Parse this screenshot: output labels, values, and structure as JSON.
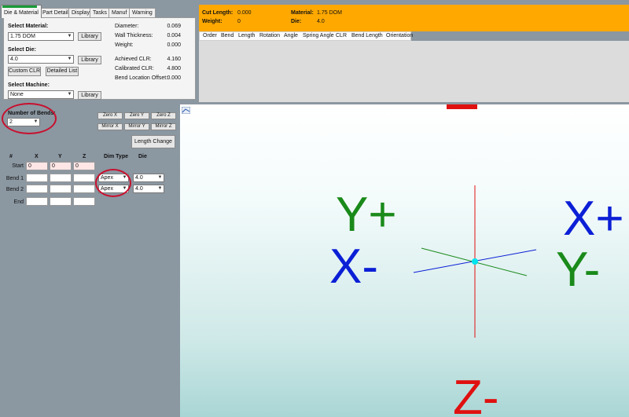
{
  "tabs": [
    {
      "label": "Die & Material",
      "active": true
    },
    {
      "label": "Part Details",
      "active": false
    },
    {
      "label": "Display",
      "active": false
    },
    {
      "label": "Tasks",
      "active": false
    },
    {
      "label": "Manuf",
      "active": false
    },
    {
      "label": "Warning",
      "active": false
    }
  ],
  "material": {
    "label": "Select Material:",
    "value": "1.75 DOM",
    "library_button": "Library"
  },
  "die": {
    "label": "Select Die:",
    "value": "4.0",
    "library_button": "Library",
    "custom_clr_button": "Custom CLR",
    "detailed_list_button": "Detailed List"
  },
  "machine": {
    "label": "Select Machine:",
    "value": "None",
    "library_button": "Library"
  },
  "properties": [
    {
      "label": "Diameter:",
      "value": "0.069"
    },
    {
      "label": "Wall Thickness:",
      "value": "0.004"
    },
    {
      "label": "Weight:",
      "value": "0.000"
    },
    {
      "label": "Achieved CLR:",
      "value": "4.160"
    },
    {
      "label": "Calibrated CLR:",
      "value": "4.800"
    },
    {
      "label": "Bend Location Offset:",
      "value": "0.000"
    }
  ],
  "info": {
    "cut_length_label": "Cut Length:",
    "cut_length_value": "0.000",
    "weight_label": "Weight:",
    "weight_value": "0",
    "material_label": "Material:",
    "material_value": "1.75 DOM",
    "die_label": "Die:",
    "die_value": "4.0"
  },
  "bend_columns": [
    "Order",
    "Bend",
    "Length",
    "Rotation",
    "Angle",
    "Spring Angle",
    "CLR",
    "Bend Length",
    "Orientation"
  ],
  "number_of_bends": {
    "label": "Number of Bends:",
    "value": "2"
  },
  "tools": {
    "zero_x": "Zero X",
    "zero_y": "Zero Y",
    "zero_z": "Zero Z",
    "mirror_x": "Mirror X",
    "mirror_y": "Mirror Y",
    "mirror_z": "Mirror Z",
    "length_change": "Length Change"
  },
  "point_grid": {
    "headers": {
      "num": "#",
      "x": "X",
      "y": "Y",
      "z": "Z",
      "dim_type": "Dim Type",
      "die": "Die"
    },
    "rows": [
      {
        "label": "Start",
        "x": "0",
        "y": "0",
        "z": "0",
        "dim_type": "",
        "die": ""
      },
      {
        "label": "Bend 1",
        "x": "",
        "y": "",
        "z": "",
        "dim_type": "Apex",
        "die": "4.0"
      },
      {
        "label": "Bend 2",
        "x": "",
        "y": "",
        "z": "",
        "dim_type": "Apex",
        "die": "4.0"
      },
      {
        "label": "End",
        "x": "",
        "y": "",
        "z": "",
        "dim_type": "",
        "die": ""
      }
    ]
  },
  "viewport": {
    "labels": {
      "y_plus": "Y+",
      "x_plus": "X+",
      "x_minus": "X-",
      "y_minus": "Y-",
      "z_minus": "Z-"
    },
    "colors": {
      "x": "#0b1fd6",
      "y": "#1a8a1a",
      "z": "#e01010",
      "origin": "#00e5ee"
    }
  },
  "colors": {
    "info_bg": "#ffa800",
    "highlight_ellipse": "#c8102e",
    "active_tab_accent": "#1a9c3a"
  }
}
